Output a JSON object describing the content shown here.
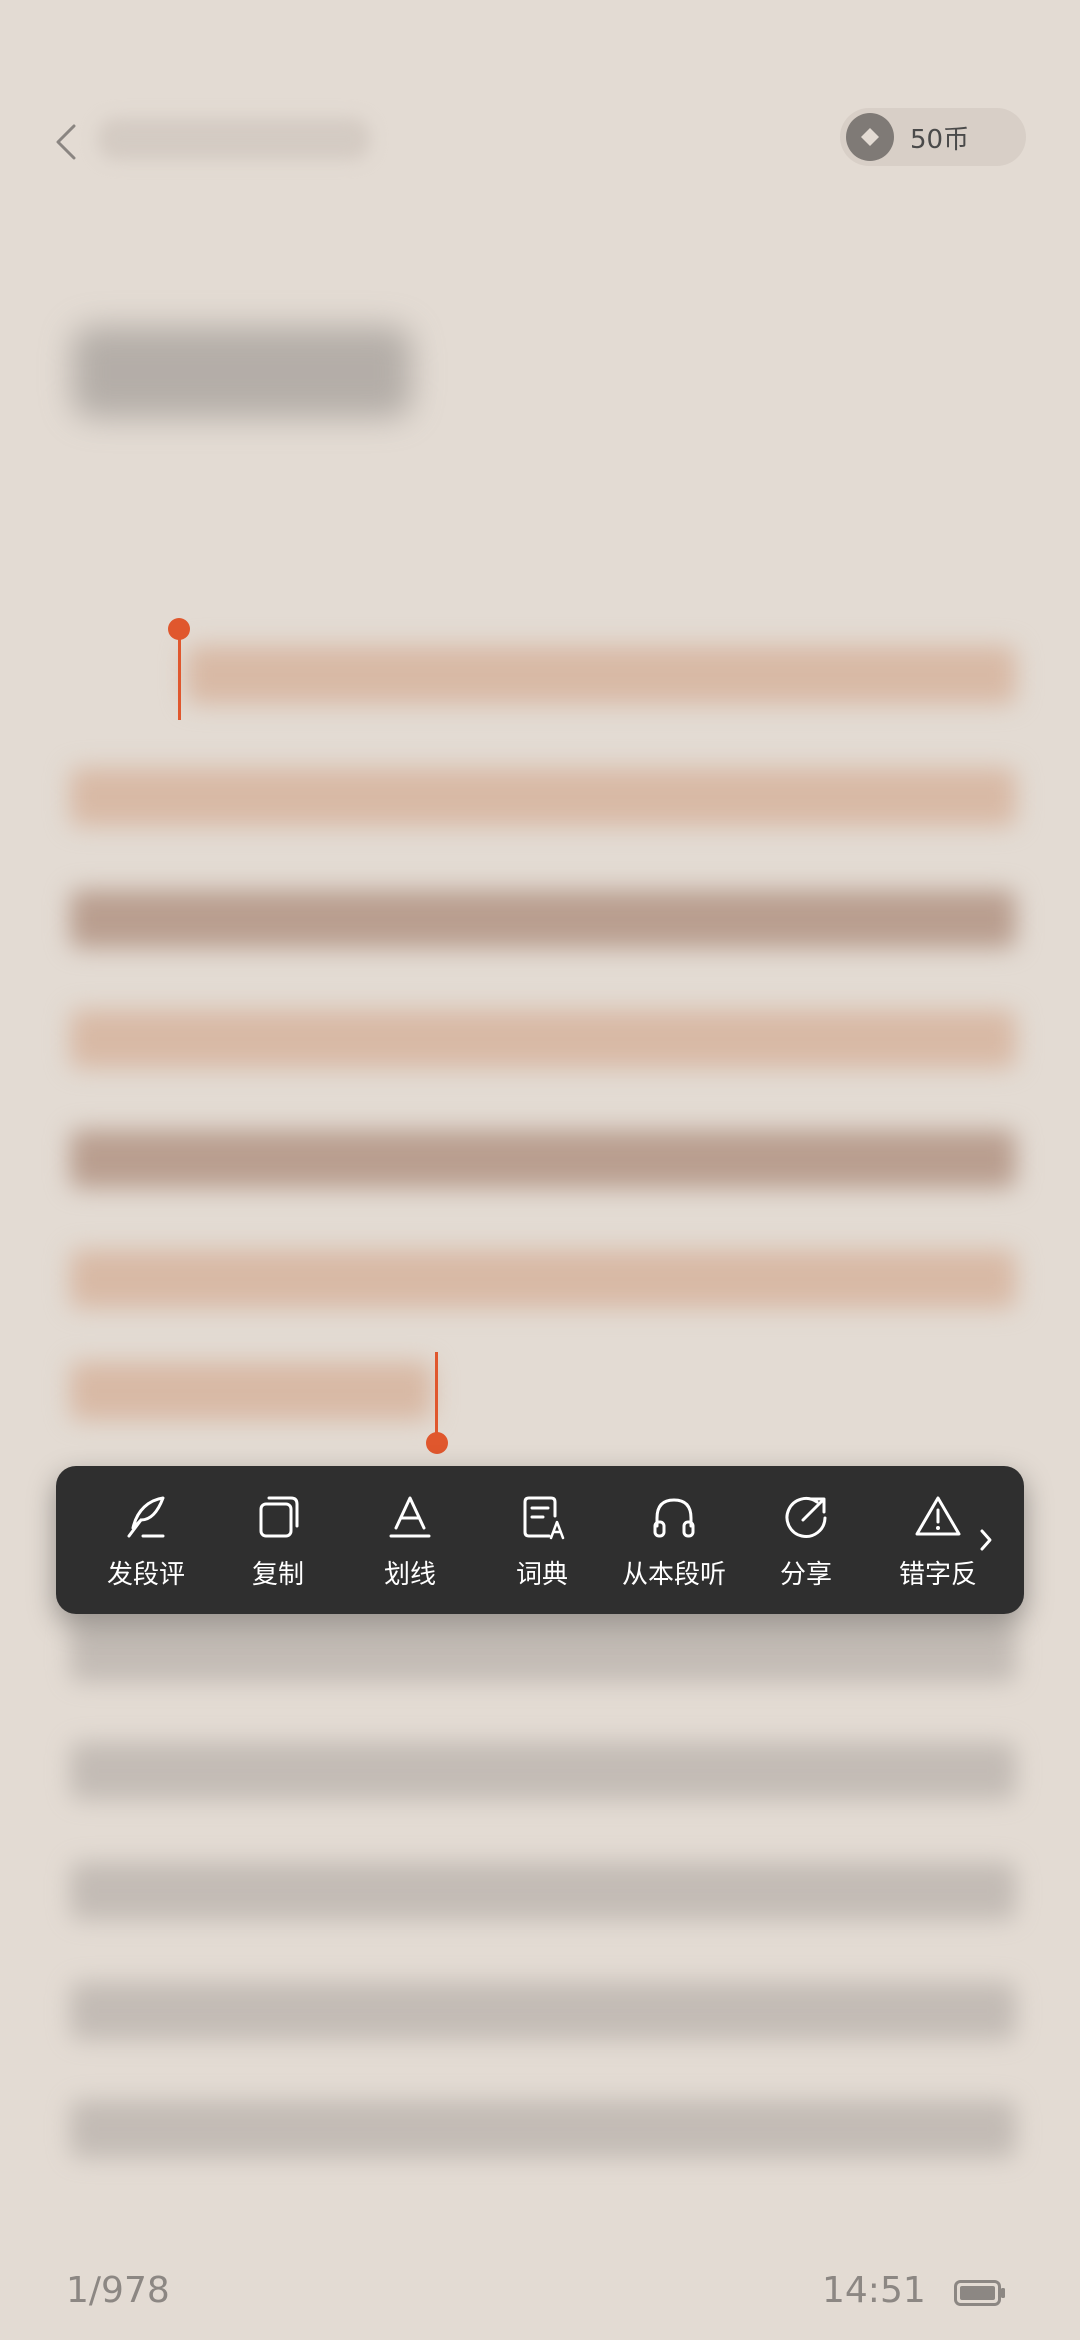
{
  "header": {
    "coins_label": "50币"
  },
  "selection_menu": {
    "items": [
      {
        "label": "发段评",
        "icon": "quill-icon"
      },
      {
        "label": "复制",
        "icon": "copy-icon"
      },
      {
        "label": "划线",
        "icon": "underline-icon"
      },
      {
        "label": "词典",
        "icon": "dictionary-icon"
      },
      {
        "label": "从本段听",
        "icon": "headphones-icon"
      },
      {
        "label": "分享",
        "icon": "share-icon"
      },
      {
        "label": "错字反",
        "icon": "warning-icon"
      }
    ]
  },
  "footer": {
    "page_indicator": "1/978",
    "time": "14:51"
  },
  "colors": {
    "accent": "#e0572d",
    "background": "#e3dbd3",
    "menu_background": "#2f2f2f"
  }
}
